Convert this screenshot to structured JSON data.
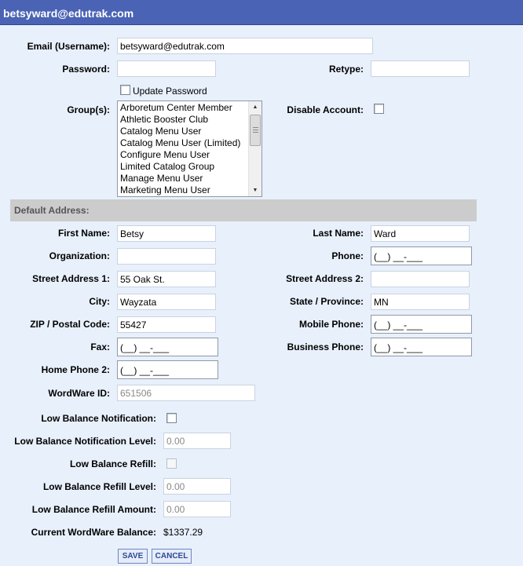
{
  "header": {
    "title": "betsyward@edutrak.com"
  },
  "account": {
    "email_label": "Email (Username):",
    "email_value": "betsyward@edutrak.com",
    "password_label": "Password:",
    "retype_label": "Retype:",
    "update_password_label": "Update Password",
    "groups_label": "Group(s):",
    "groups": [
      "Arboretum Center Member",
      "Athletic Booster Club",
      "Catalog Menu User",
      "Catalog Menu User (Limited)",
      "Configure Menu User",
      "Limited Catalog Group",
      "Manage Menu User",
      "Marketing Menu User"
    ],
    "disable_account_label": "Disable Account:"
  },
  "address": {
    "section_title": "Default Address:",
    "first_name_label": "First Name:",
    "first_name_value": "Betsy",
    "last_name_label": "Last Name:",
    "last_name_value": "Ward",
    "organization_label": "Organization:",
    "phone_label": "Phone:",
    "street1_label": "Street Address 1:",
    "street1_value": "55 Oak St.",
    "street2_label": "Street Address 2:",
    "city_label": "City:",
    "city_value": "Wayzata",
    "state_label": "State / Province:",
    "state_value": "MN",
    "zip_label": "ZIP / Postal Code:",
    "zip_value": "55427",
    "mobile_label": "Mobile Phone:",
    "fax_label": "Fax:",
    "business_phone_label": "Business Phone:",
    "home_phone2_label": "Home Phone 2:",
    "phone_mask": "(__) __-___"
  },
  "wordware": {
    "id_label": "WordWare ID:",
    "id_value": "651506",
    "low_balance_notification_label": "Low Balance Notification:",
    "low_balance_notification_level_label": "Low Balance Notification Level:",
    "low_balance_notification_level_value": "0.00",
    "low_balance_refill_label": "Low Balance Refill:",
    "low_balance_refill_level_label": "Low Balance Refill Level:",
    "low_balance_refill_level_value": "0.00",
    "low_balance_refill_amount_label": "Low Balance Refill Amount:",
    "low_balance_refill_amount_value": "0.00",
    "current_balance_label": "Current WordWare Balance:",
    "current_balance_value": "$1337.29"
  },
  "actions": {
    "save_label": "SAVE",
    "cancel_label": "CANCEL"
  },
  "colors": {
    "header_bg": "#4a63b4",
    "page_bg": "#e8f0fb",
    "section_bg": "#cccccc",
    "button_text": "#2a4a9a"
  }
}
